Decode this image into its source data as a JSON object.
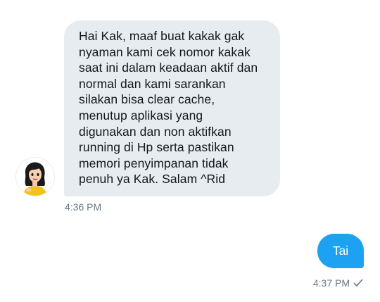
{
  "conversation": {
    "received": {
      "text": "Hai Kak, maaf buat kakak gak\nnyaman kami cek nomor kakak\nsaat ini dalam keadaan aktif dan\nnormal dan kami sarankan\nsilakan bisa clear cache,\nmenutup aplikasi yang\ndigunakan dan non aktifkan\nrunning di Hp serta pastikan\nmemori penyimpanan tidak\npenuh ya Kak. Salam ^Rid",
      "time": "4:36 PM",
      "avatar_icon": "cartoon-woman-avatar-icon"
    },
    "sent": {
      "text": "Tai",
      "time": "4:37 PM",
      "status_icon": "check-icon"
    }
  },
  "colors": {
    "received_bubble": "#e6ecf0",
    "sent_bubble": "#1da1f2",
    "timestamp": "#657786"
  }
}
